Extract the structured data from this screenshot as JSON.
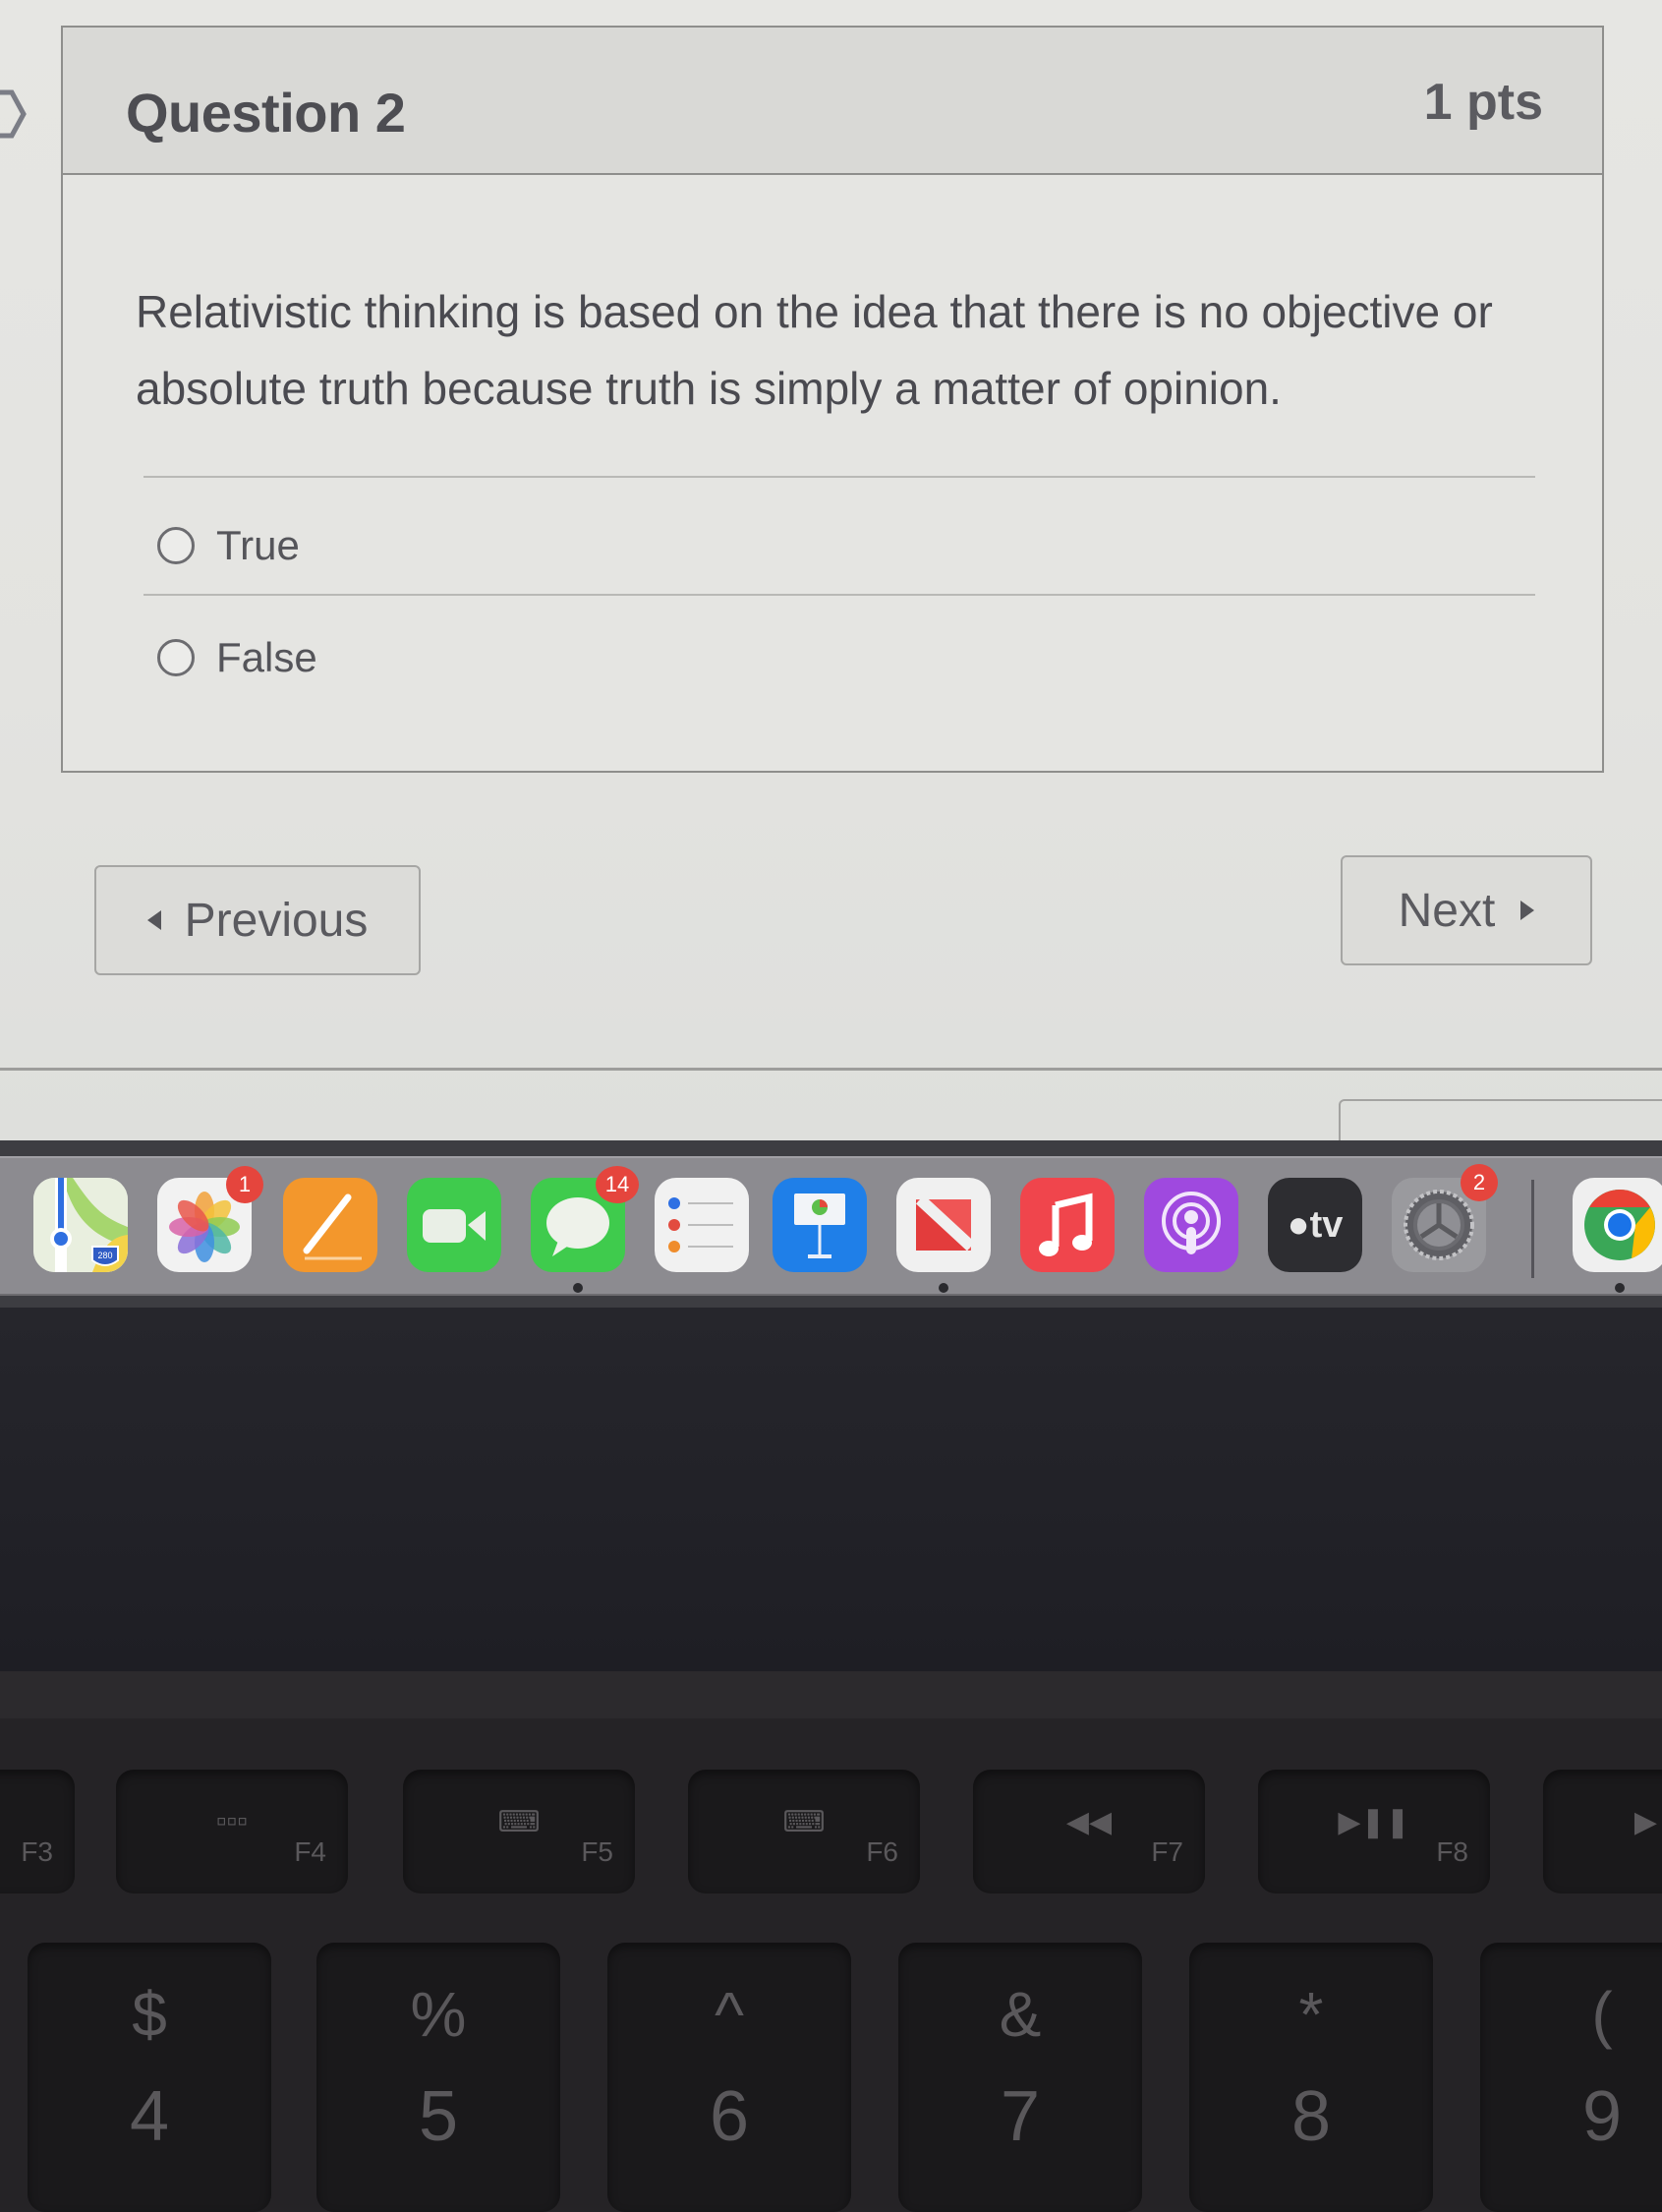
{
  "quiz": {
    "question_title": "Question 2",
    "points": "1 pts",
    "question_text": "Relativistic thinking is based on the idea that there is no objective or absolute truth because truth is simply a matter of opinion.",
    "options": [
      {
        "label": "True",
        "selected": false
      },
      {
        "label": "False",
        "selected": false
      }
    ],
    "previous_label": "Previous",
    "next_label": "Next"
  },
  "dock": {
    "apps": [
      {
        "name": "Maps",
        "icon": "maps-icon",
        "badge": null,
        "running": false
      },
      {
        "name": "Photos",
        "icon": "photos-icon",
        "badge": "1",
        "running": false
      },
      {
        "name": "Pages",
        "icon": "pages-icon",
        "badge": null,
        "running": false
      },
      {
        "name": "FaceTime",
        "icon": "facetime-icon",
        "badge": null,
        "running": false
      },
      {
        "name": "Messages",
        "icon": "messages-icon",
        "badge": "14",
        "running": true
      },
      {
        "name": "Reminders",
        "icon": "reminders-icon",
        "badge": null,
        "running": false
      },
      {
        "name": "Keynote",
        "icon": "keynote-icon",
        "badge": null,
        "running": false
      },
      {
        "name": "News",
        "icon": "news-icon",
        "badge": null,
        "running": true
      },
      {
        "name": "Music",
        "icon": "music-icon",
        "badge": null,
        "running": false
      },
      {
        "name": "Podcasts",
        "icon": "podcasts-icon",
        "badge": null,
        "running": false
      },
      {
        "name": "TV",
        "icon": "apple-tv-icon",
        "badge": null,
        "running": false,
        "text": "tv"
      },
      {
        "name": "System Preferences",
        "icon": "system-preferences-icon",
        "badge": "2",
        "running": false
      },
      {
        "name": "Chrome",
        "icon": "chrome-icon",
        "badge": null,
        "running": true
      }
    ],
    "maps_shield_text": "280"
  },
  "keyboard": {
    "function_keys": [
      {
        "label": "F3",
        "glyph": ""
      },
      {
        "label": "F4",
        "glyph": "▫▫▫"
      },
      {
        "label": "F5",
        "glyph": "⌨"
      },
      {
        "label": "F6",
        "glyph": "⌨"
      },
      {
        "label": "F7",
        "glyph": "◀◀"
      },
      {
        "label": "F8",
        "glyph": "▶❚❚"
      },
      {
        "label": "",
        "glyph": "▶"
      }
    ],
    "number_keys": [
      {
        "shift": "$",
        "num": "4"
      },
      {
        "shift": "%",
        "num": "5"
      },
      {
        "shift": "^",
        "num": "6"
      },
      {
        "shift": "&",
        "num": "7"
      },
      {
        "shift": "*",
        "num": "8"
      },
      {
        "shift": "(",
        "num": "9"
      }
    ]
  }
}
